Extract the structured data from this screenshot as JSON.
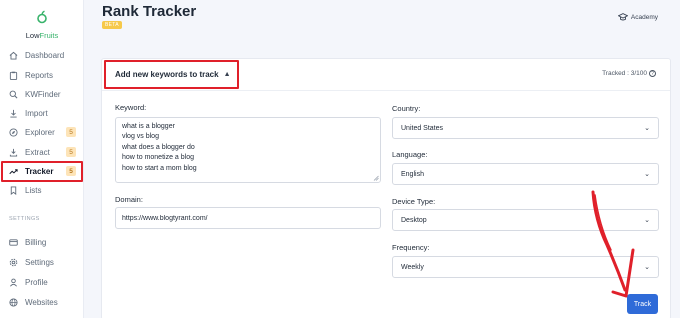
{
  "brand": {
    "name_part1": "Low",
    "name_part2": "Fruits",
    "accent": "#38b36b"
  },
  "sidebar": {
    "items": [
      {
        "label": "Dashboard",
        "icon": "home-icon",
        "badge": ""
      },
      {
        "label": "Reports",
        "icon": "clipboard-icon",
        "badge": ""
      },
      {
        "label": "KWFinder",
        "icon": "search-icon",
        "badge": ""
      },
      {
        "label": "Import",
        "icon": "download-icon",
        "badge": ""
      },
      {
        "label": "Explorer",
        "icon": "compass-icon",
        "badge": "5"
      },
      {
        "label": "Extract",
        "icon": "extract-icon",
        "badge": "5"
      },
      {
        "label": "Tracker",
        "icon": "trending-icon",
        "badge": "5"
      },
      {
        "label": "Lists",
        "icon": "bookmark-icon",
        "badge": ""
      }
    ],
    "settings_label": "SETTINGS",
    "settings_items": [
      {
        "label": "Billing",
        "icon": "card-icon"
      },
      {
        "label": "Settings",
        "icon": "gear-icon"
      },
      {
        "label": "Profile",
        "icon": "user-icon"
      },
      {
        "label": "Websites",
        "icon": "globe-icon"
      }
    ]
  },
  "header": {
    "title": "Rank Tracker",
    "badge": "BETA",
    "academy_label": "Academy"
  },
  "card": {
    "toggle_label": "Add new keywords to track",
    "tracked_text": "Tracked : 3/100",
    "keyword_label": "Keyword:",
    "keywords": "what is a blogger\nvlog vs blog\nwhat does a blogger do\nhow to monetize a blog\nhow to start a mom blog",
    "domain_label": "Domain:",
    "domain_value": "https://www.blogtyrant.com/",
    "country_label": "Country:",
    "country_value": "United States",
    "language_label": "Language:",
    "language_value": "English",
    "device_label": "Device Type:",
    "device_value": "Desktop",
    "frequency_label": "Frequency:",
    "frequency_value": "Weekly",
    "track_label": "Track"
  },
  "colors": {
    "primary": "#2f6bd8",
    "highlight": "#e0202a",
    "beta": "#f6c94a"
  }
}
